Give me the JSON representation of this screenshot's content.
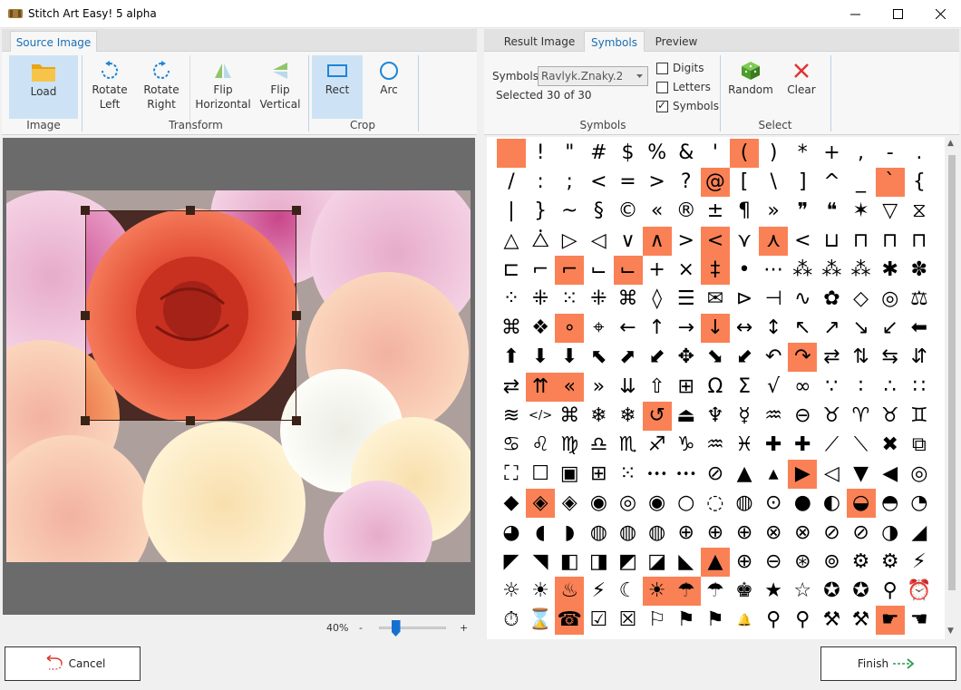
{
  "window": {
    "title": "Stitch Art Easy! 5 alpha"
  },
  "left_pane": {
    "tabs": [
      {
        "label": "Source Image",
        "active": true
      }
    ],
    "ribbon": {
      "groups": [
        {
          "label": "Image",
          "buttons": [
            {
              "label": "Load",
              "icon": "folder-icon",
              "selected": true
            }
          ]
        },
        {
          "label": "Transform",
          "buttons": [
            {
              "label": "Rotate Left",
              "icon": "rotate-left-icon"
            },
            {
              "label": "Rotate Right",
              "icon": "rotate-right-icon"
            },
            {
              "label": "Flip Horizontal",
              "icon": "flip-horizontal-icon"
            },
            {
              "label": "Flip Vertical",
              "icon": "flip-vertical-icon"
            }
          ]
        },
        {
          "label": "Crop",
          "buttons": [
            {
              "label": "Rect",
              "icon": "rectangle-icon",
              "selected": true
            },
            {
              "label": "Arc",
              "icon": "circle-icon"
            }
          ]
        }
      ]
    },
    "zoom": {
      "label": "40%",
      "minus": "-",
      "plus": "+",
      "value_fraction": 0.25
    }
  },
  "right_pane": {
    "tabs": [
      {
        "label": "Result Image",
        "active": false
      },
      {
        "label": "Symbols",
        "active": true
      },
      {
        "label": "Preview",
        "active": false
      }
    ],
    "symbols": {
      "label": "Symbols",
      "selected_font": "Ravlyk.Znaky.2",
      "selected_count": "Selected 30 of 30",
      "group_label": "Symbols",
      "filters": [
        {
          "label": "Digits",
          "checked": false
        },
        {
          "label": "Letters",
          "checked": false
        },
        {
          "label": "Symbols",
          "checked": true
        }
      ]
    },
    "select": {
      "group_label": "Select",
      "random_label": "Random",
      "clear_label": "Clear"
    }
  },
  "symbol_grid": {
    "rows": [
      [
        "",
        "!",
        "\"",
        "#",
        "$",
        "%",
        "&",
        "'",
        "(",
        ")",
        "*",
        "+",
        ",",
        "-",
        "."
      ],
      [
        "/",
        ":",
        ";",
        "<",
        "=",
        ">",
        "?",
        "@",
        "[",
        "\\",
        "]",
        "^",
        "_",
        "`",
        "{"
      ],
      [
        "|",
        "}",
        "~",
        "§",
        "©",
        "«",
        "®",
        "±",
        "¶",
        "»",
        "❞",
        "❝",
        "✶",
        "▽",
        "⧖"
      ],
      [
        "△",
        "⧊",
        "▷",
        "◁",
        "∨",
        "∧",
        ">",
        "<",
        "⋎",
        "⋏",
        "<",
        "⊔",
        "⊓",
        "⊓",
        "⊓"
      ],
      [
        "⊏",
        "⌐",
        "⌐",
        "⌙",
        "⌙",
        "+",
        "×",
        "‡",
        "•",
        "⋯",
        "⁂",
        "⁂",
        "⁂",
        "✱",
        "✽"
      ],
      [
        "⁘",
        "⁜",
        "⁙",
        "⁜",
        "⌘",
        "◊",
        "☰",
        "✉",
        "⊳",
        "⊣",
        "∿",
        "✿",
        "◇",
        "◎",
        "⚖"
      ],
      [
        "⌘",
        "❖",
        "∘",
        "⌖",
        "←",
        "↑",
        "→",
        "↓",
        "↔",
        "↕",
        "↖",
        "↗",
        "↘",
        "↙",
        "⬅"
      ],
      [
        "⬆",
        "⬇",
        "⬇",
        "⬉",
        "⬈",
        "⬋",
        "✥",
        "⬊",
        "⬋",
        "↶",
        "↷",
        "⇄",
        "⇅",
        "⇆",
        "⇵"
      ],
      [
        "⇄",
        "⇈",
        "«",
        "»",
        "⇊",
        "⇧",
        "⊞",
        "Ω",
        "Σ",
        "√",
        "∞",
        "∵",
        "∶",
        "∴",
        "∷"
      ],
      [
        "≋",
        "</>",
        "⌘",
        "❄",
        "❄",
        "↺",
        "⏏",
        "♆",
        "☿",
        "♒",
        "⊖",
        "♉",
        "♈",
        "♉",
        "♊"
      ],
      [
        "♋",
        "♌",
        "♍",
        "♎",
        "♏",
        "♐",
        "♑",
        "♒",
        "♓",
        "✚",
        "✚",
        "⟋",
        "⟍",
        "✖",
        "⧉"
      ],
      [
        "⛶",
        "☐",
        "▣",
        "⊞",
        "⁙",
        "•••",
        "•••",
        "⊘",
        "▲",
        "▴",
        "▶",
        "◁",
        "▼",
        "◀",
        "◎"
      ],
      [
        "◆",
        "◈",
        "◈",
        "◉",
        "◎",
        "◉",
        "○",
        "◌",
        "◍",
        "⊙",
        "●",
        "◐",
        "◒",
        "◓",
        "◔"
      ],
      [
        "◕",
        "◖",
        "◗",
        "◍",
        "◍",
        "◍",
        "⊕",
        "⊕",
        "⊕",
        "⊗",
        "⊗",
        "⊘",
        "⊘",
        "◑",
        "◢"
      ],
      [
        "◤",
        "◥",
        "◧",
        "◨",
        "◩",
        "◪",
        "◣",
        "▲",
        "⊕",
        "⊖",
        "⊛",
        "⊚",
        "⚙",
        "⚙",
        "⚡"
      ],
      [
        "☼",
        "☀",
        "♨",
        "⚡",
        "☾",
        "☀",
        "☂",
        "☂",
        "♚",
        "★",
        "☆",
        "✪",
        "✪",
        "⚲",
        "⏰"
      ],
      [
        "⏱",
        "⌛",
        "☎",
        "☑",
        "☒",
        "⚐",
        "⚑",
        "⚑",
        "🔔",
        "⚲",
        "⚲",
        "⚒",
        "⚒",
        "☛",
        "☚"
      ]
    ],
    "selected": [
      [
        0,
        0
      ],
      [
        0,
        8
      ],
      [
        1,
        7
      ],
      [
        1,
        13
      ],
      [
        3,
        5
      ],
      [
        3,
        7
      ],
      [
        3,
        9
      ],
      [
        4,
        2
      ],
      [
        4,
        4
      ],
      [
        4,
        7
      ],
      [
        6,
        2
      ],
      [
        6,
        7
      ],
      [
        7,
        10
      ],
      [
        8,
        1
      ],
      [
        8,
        2
      ],
      [
        9,
        5
      ],
      [
        11,
        10
      ],
      [
        12,
        1
      ],
      [
        12,
        12
      ],
      [
        14,
        7
      ],
      [
        15,
        2
      ],
      [
        15,
        5
      ],
      [
        15,
        6
      ],
      [
        16,
        2
      ],
      [
        16,
        13
      ]
    ]
  },
  "footer": {
    "cancel_label": "Cancel",
    "finish_label": "Finish"
  },
  "colors": {
    "accent": "#1a6fb5",
    "symbol_selected": "#fa8155",
    "ribbon_selected": "#cde3f5",
    "canvas_bg": "#6b6b6b"
  }
}
